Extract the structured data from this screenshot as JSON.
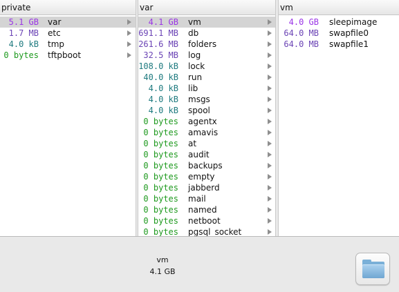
{
  "columns": [
    {
      "title": "private",
      "rows": [
        {
          "size": "5.1 GB",
          "unit": "gb",
          "name": "var",
          "arrow": true,
          "selected": true
        },
        {
          "size": "1.7 MB",
          "unit": "mb",
          "name": "etc",
          "arrow": true
        },
        {
          "size": "4.0 kB",
          "unit": "kb",
          "name": "tmp",
          "arrow": true
        },
        {
          "size": "0 bytes",
          "unit": "b",
          "name": "tftpboot",
          "arrow": true
        }
      ]
    },
    {
      "title": "var",
      "rows": [
        {
          "size": "4.1 GB",
          "unit": "gb",
          "name": "vm",
          "arrow": true,
          "selected": true
        },
        {
          "size": "691.1 MB",
          "unit": "mb",
          "name": "db",
          "arrow": true
        },
        {
          "size": "261.6 MB",
          "unit": "mb",
          "name": "folders",
          "arrow": true
        },
        {
          "size": "32.5 MB",
          "unit": "mb",
          "name": "log",
          "arrow": true
        },
        {
          "size": "108.0 kB",
          "unit": "kb",
          "name": "lock",
          "arrow": true
        },
        {
          "size": "40.0 kB",
          "unit": "kb",
          "name": "run",
          "arrow": true
        },
        {
          "size": "4.0 kB",
          "unit": "kb",
          "name": "lib",
          "arrow": true
        },
        {
          "size": "4.0 kB",
          "unit": "kb",
          "name": "msgs",
          "arrow": true
        },
        {
          "size": "4.0 kB",
          "unit": "kb",
          "name": "spool",
          "arrow": true
        },
        {
          "size": "0 bytes",
          "unit": "b",
          "name": "agentx",
          "arrow": true
        },
        {
          "size": "0 bytes",
          "unit": "b",
          "name": "amavis",
          "arrow": true
        },
        {
          "size": "0 bytes",
          "unit": "b",
          "name": "at",
          "arrow": true
        },
        {
          "size": "0 bytes",
          "unit": "b",
          "name": "audit",
          "arrow": true
        },
        {
          "size": "0 bytes",
          "unit": "b",
          "name": "backups",
          "arrow": true
        },
        {
          "size": "0 bytes",
          "unit": "b",
          "name": "empty",
          "arrow": true
        },
        {
          "size": "0 bytes",
          "unit": "b",
          "name": "jabberd",
          "arrow": true
        },
        {
          "size": "0 bytes",
          "unit": "b",
          "name": "mail",
          "arrow": true
        },
        {
          "size": "0 bytes",
          "unit": "b",
          "name": "named",
          "arrow": true
        },
        {
          "size": "0 bytes",
          "unit": "b",
          "name": "netboot",
          "arrow": true
        },
        {
          "size": "0 bytes",
          "unit": "b",
          "name": "pgsql_socket",
          "arrow": true
        }
      ]
    },
    {
      "title": "vm",
      "rows": [
        {
          "size": "4.0 GB",
          "unit": "gb",
          "name": "sleepimage",
          "arrow": false
        },
        {
          "size": "64.0 MB",
          "unit": "mb",
          "name": "swapfile0",
          "arrow": false
        },
        {
          "size": "64.0 MB",
          "unit": "mb",
          "name": "swapfile1",
          "arrow": false
        }
      ]
    }
  ],
  "info": {
    "name": "vm",
    "size": "4.1 GB"
  },
  "colors": {
    "gb": "#9a34e6",
    "mb": "#6b44b5",
    "kb": "#1e7a7f",
    "bytes": "#1f9a1f",
    "selected_row": "#d4d4d4"
  },
  "icons": {
    "reveal_button": "folder-icon",
    "disclosure": "triangle-right-icon"
  }
}
